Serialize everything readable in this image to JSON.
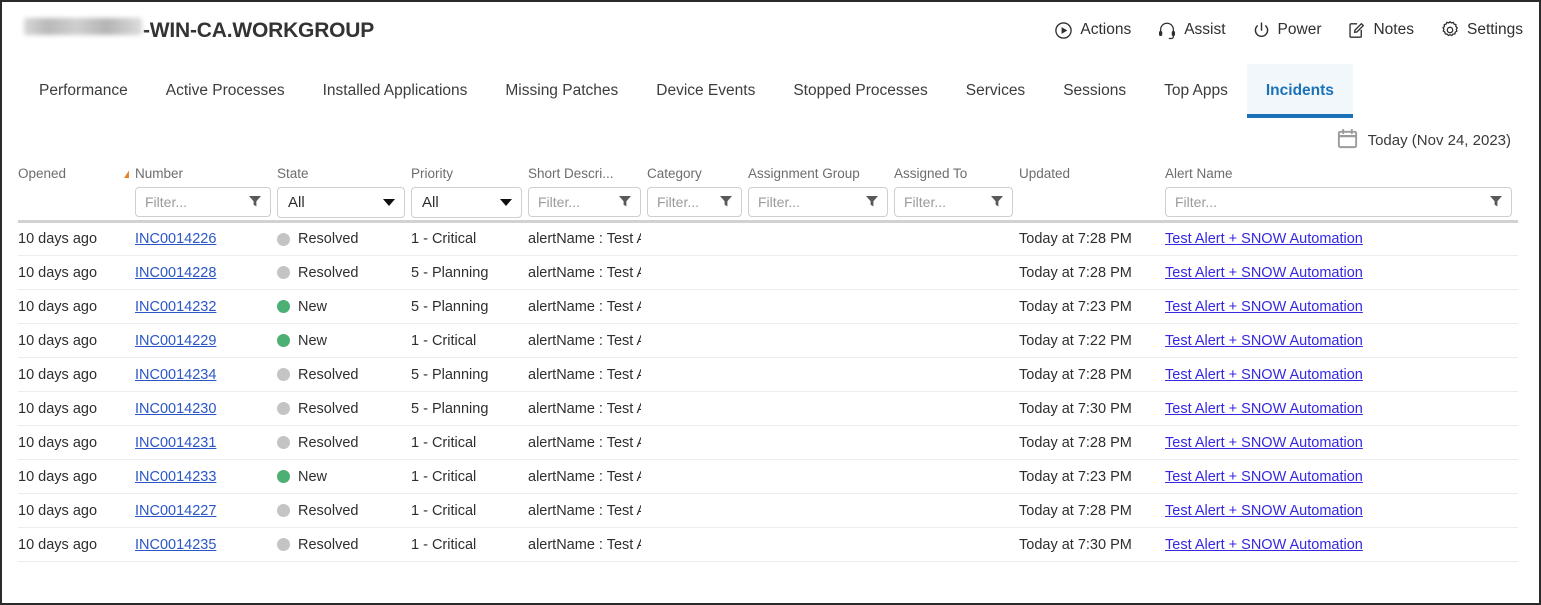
{
  "header": {
    "title_suffix": "-WIN-CA.WORKGROUP",
    "actions": [
      {
        "label": "Actions",
        "icon": "play-circle-icon"
      },
      {
        "label": "Assist",
        "icon": "headset-icon"
      },
      {
        "label": "Power",
        "icon": "power-icon"
      },
      {
        "label": "Notes",
        "icon": "note-edit-icon"
      },
      {
        "label": "Settings",
        "icon": "gear-icon"
      }
    ]
  },
  "tabs": [
    {
      "label": "Performance",
      "active": false
    },
    {
      "label": "Active Processes",
      "active": false
    },
    {
      "label": "Installed Applications",
      "active": false
    },
    {
      "label": "Missing Patches",
      "active": false
    },
    {
      "label": "Device Events",
      "active": false
    },
    {
      "label": "Stopped Processes",
      "active": false
    },
    {
      "label": "Services",
      "active": false
    },
    {
      "label": "Sessions",
      "active": false
    },
    {
      "label": "Top Apps",
      "active": false
    },
    {
      "label": "Incidents",
      "active": true
    }
  ],
  "datepicker": {
    "label": "Today (Nov 24, 2023)",
    "icon": "calendar-icon"
  },
  "table": {
    "columns": [
      {
        "header": "Opened",
        "control": "sort-asc"
      },
      {
        "header": "Number",
        "control": "filter",
        "value": "",
        "placeholder": "Filter..."
      },
      {
        "header": "State",
        "control": "select",
        "value": "All"
      },
      {
        "header": "Priority",
        "control": "select",
        "value": "All"
      },
      {
        "header": "Short Descri...",
        "control": "filter",
        "value": "",
        "placeholder": "Filter..."
      },
      {
        "header": "Category",
        "control": "filter",
        "value": "",
        "placeholder": "Filter..."
      },
      {
        "header": "Assignment Group",
        "control": "filter",
        "value": "",
        "placeholder": "Filter..."
      },
      {
        "header": "Assigned To",
        "control": "filter",
        "value": "",
        "placeholder": "Filter..."
      },
      {
        "header": "Updated",
        "control": "none"
      },
      {
        "header": "Alert Name",
        "control": "filter",
        "value": "",
        "placeholder": "Filter..."
      }
    ],
    "state_colors": {
      "New": "#4caf73",
      "Resolved": "#c4c4c4"
    },
    "rows": [
      {
        "opened": "10 days ago",
        "number": "INC0014226",
        "state": "Resolved",
        "priority": "1 - Critical",
        "short_description": "alertName : Test Al",
        "category": "",
        "assignment_group": "",
        "assigned_to": "",
        "updated": "Today at 7:28 PM",
        "alert_name": "Test Alert + SNOW Automation"
      },
      {
        "opened": "10 days ago",
        "number": "INC0014228",
        "state": "Resolved",
        "priority": "5 - Planning",
        "short_description": "alertName : Test Al",
        "category": "",
        "assignment_group": "",
        "assigned_to": "",
        "updated": "Today at 7:28 PM",
        "alert_name": "Test Alert + SNOW Automation"
      },
      {
        "opened": "10 days ago",
        "number": "INC0014232",
        "state": "New",
        "priority": "5 - Planning",
        "short_description": "alertName : Test Al",
        "category": "",
        "assignment_group": "",
        "assigned_to": "",
        "updated": "Today at 7:23 PM",
        "alert_name": "Test Alert + SNOW Automation"
      },
      {
        "opened": "10 days ago",
        "number": "INC0014229",
        "state": "New",
        "priority": "1 - Critical",
        "short_description": "alertName : Test Al",
        "category": "",
        "assignment_group": "",
        "assigned_to": "",
        "updated": "Today at 7:22 PM",
        "alert_name": "Test Alert + SNOW Automation"
      },
      {
        "opened": "10 days ago",
        "number": "INC0014234",
        "state": "Resolved",
        "priority": "5 - Planning",
        "short_description": "alertName : Test Al",
        "category": "",
        "assignment_group": "",
        "assigned_to": "",
        "updated": "Today at 7:28 PM",
        "alert_name": "Test Alert + SNOW Automation"
      },
      {
        "opened": "10 days ago",
        "number": "INC0014230",
        "state": "Resolved",
        "priority": "5 - Planning",
        "short_description": "alertName : Test Al",
        "category": "",
        "assignment_group": "",
        "assigned_to": "",
        "updated": "Today at 7:30 PM",
        "alert_name": "Test Alert + SNOW Automation"
      },
      {
        "opened": "10 days ago",
        "number": "INC0014231",
        "state": "Resolved",
        "priority": "1 - Critical",
        "short_description": "alertName : Test Al",
        "category": "",
        "assignment_group": "",
        "assigned_to": "",
        "updated": "Today at 7:28 PM",
        "alert_name": "Test Alert + SNOW Automation"
      },
      {
        "opened": "10 days ago",
        "number": "INC0014233",
        "state": "New",
        "priority": "1 - Critical",
        "short_description": "alertName : Test Al",
        "category": "",
        "assignment_group": "",
        "assigned_to": "",
        "updated": "Today at 7:23 PM",
        "alert_name": "Test Alert + SNOW Automation"
      },
      {
        "opened": "10 days ago",
        "number": "INC0014227",
        "state": "Resolved",
        "priority": "1 - Critical",
        "short_description": "alertName : Test Al",
        "category": "",
        "assignment_group": "",
        "assigned_to": "",
        "updated": "Today at 7:28 PM",
        "alert_name": "Test Alert + SNOW Automation"
      },
      {
        "opened": "10 days ago",
        "number": "INC0014235",
        "state": "Resolved",
        "priority": "1 - Critical",
        "short_description": "alertName : Test Al",
        "category": "",
        "assignment_group": "",
        "assigned_to": "",
        "updated": "Today at 7:30 PM",
        "alert_name": "Test Alert + SNOW Automation"
      }
    ]
  }
}
